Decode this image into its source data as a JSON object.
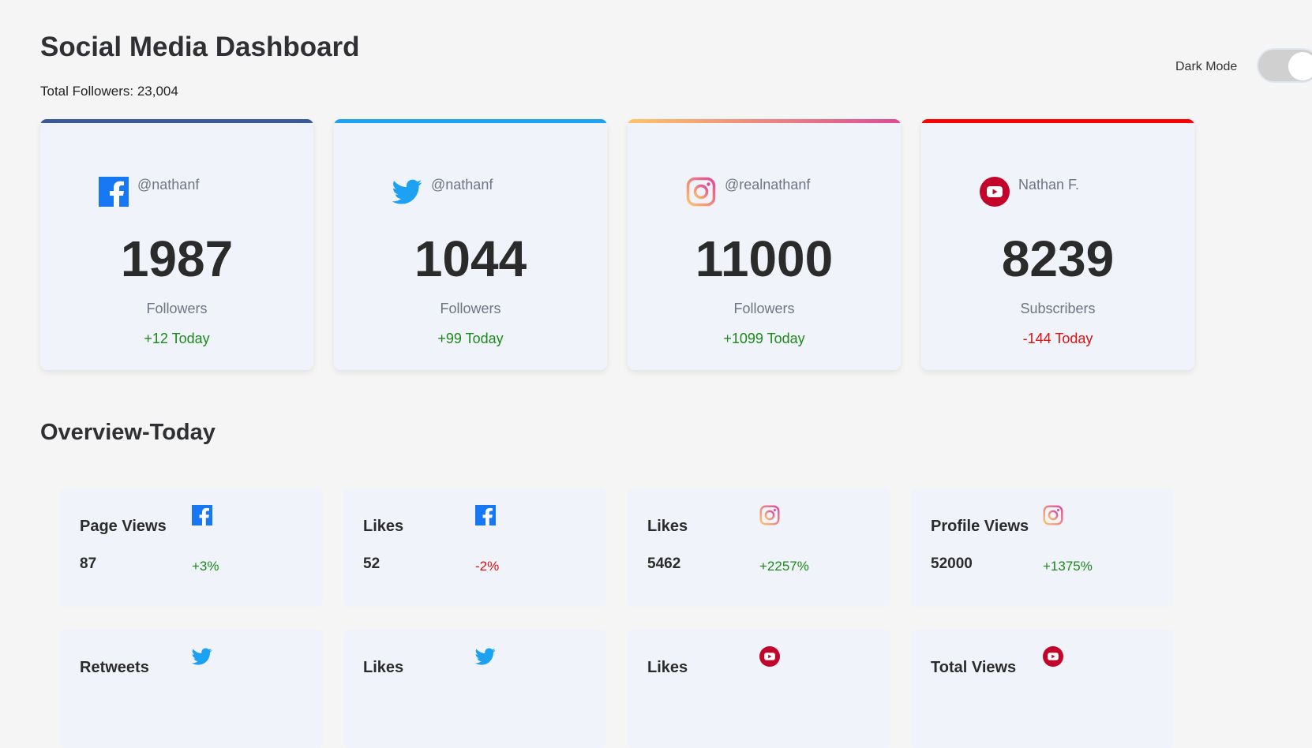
{
  "header": {
    "title": "Social Media Dashboard",
    "total_followers": "Total Followers: 23,004",
    "dark_mode_label": "Dark Mode",
    "dark_mode_on": false
  },
  "colors": {
    "facebook": "#3b5998",
    "twitter": "#1da1f2",
    "instagram_gradient": [
      "#fdc468",
      "#df4996"
    ],
    "youtube": "#ff0000",
    "youtube_icon": "#c4032b",
    "positive": "#1a8a1a",
    "negative": "#e01010"
  },
  "cards": [
    {
      "platform": "facebook",
      "icon": "facebook-icon",
      "handle": "@nathanf",
      "count": "1987",
      "label": "Followers",
      "change": "+12 Today",
      "trend": "up"
    },
    {
      "platform": "twitter",
      "icon": "twitter-icon",
      "handle": "@nathanf",
      "count": "1044",
      "label": "Followers",
      "change": "+99 Today",
      "trend": "up"
    },
    {
      "platform": "instagram",
      "icon": "instagram-icon",
      "handle": "@realnathanf",
      "count": "11000",
      "label": "Followers",
      "change": "+1099 Today",
      "trend": "up"
    },
    {
      "platform": "youtube",
      "icon": "youtube-icon",
      "handle": "Nathan F.",
      "count": "8239",
      "label": "Subscribers",
      "change": "-144 Today",
      "trend": "down"
    }
  ],
  "overview": {
    "title": "Overview-Today",
    "items": [
      {
        "metric": "Page Views",
        "icon": "facebook-icon",
        "value": "87",
        "change": "+3%",
        "trend": "up"
      },
      {
        "metric": "Likes",
        "icon": "facebook-icon",
        "value": "52",
        "change": "-2%",
        "trend": "down"
      },
      {
        "metric": "Likes",
        "icon": "instagram-icon",
        "value": "5462",
        "change": "+2257%",
        "trend": "up"
      },
      {
        "metric": "Profile Views",
        "icon": "instagram-icon",
        "value": "52000",
        "change": "+1375%",
        "trend": "up"
      },
      {
        "metric": "Retweets",
        "icon": "twitter-icon"
      },
      {
        "metric": "Likes",
        "icon": "twitter-icon"
      },
      {
        "metric": "Likes",
        "icon": "youtube-icon"
      },
      {
        "metric": "Total Views",
        "icon": "youtube-icon"
      }
    ]
  }
}
